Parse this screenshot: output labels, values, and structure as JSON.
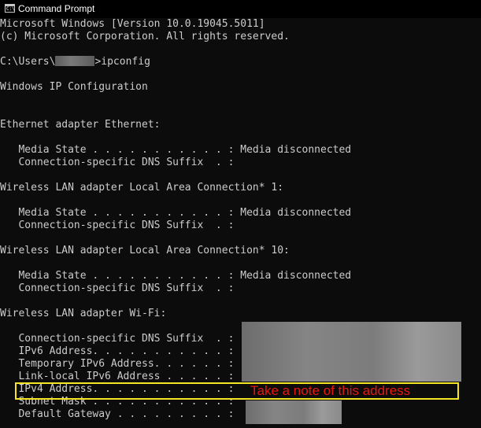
{
  "window": {
    "title": "Command Prompt",
    "icon_glyph": "C:\\",
    "icon": "console-app-icon"
  },
  "console": {
    "banner": [
      "Microsoft Windows [Version 10.0.19045.5011]",
      "(c) Microsoft Corporation. All rights reserved."
    ],
    "prompt_prefix": "C:\\Users\\",
    "prompt_suffix": ">ipconfig",
    "heading": "Windows IP Configuration",
    "adapters": [
      {
        "header": "Ethernet adapter Ethernet:",
        "lines": [
          "   Media State . . . . . . . . . . . : Media disconnected",
          "   Connection-specific DNS Suffix  . :"
        ]
      },
      {
        "header": "Wireless LAN adapter Local Area Connection* 1:",
        "lines": [
          "   Media State . . . . . . . . . . . : Media disconnected",
          "   Connection-specific DNS Suffix  . :"
        ]
      },
      {
        "header": "Wireless LAN adapter Local Area Connection* 10:",
        "lines": [
          "   Media State . . . . . . . . . . . : Media disconnected",
          "   Connection-specific DNS Suffix  . :"
        ]
      },
      {
        "header": "Wireless LAN adapter Wi-Fi:",
        "lines": [
          "   Connection-specific DNS Suffix  . :",
          "   IPv6 Address. . . . . . . . . . . :",
          "   Temporary IPv6 Address. . . . . . :",
          "   Link-local IPv6 Address . . . . . :",
          "   IPv4 Address. . . . . . . . . . . :",
          "   Subnet Mask . . . . . . . . . . . :",
          "   Default Gateway . . . . . . . . . :"
        ]
      }
    ]
  },
  "annotation": {
    "text": "Take a note of this address",
    "text_color": "#e8170c",
    "box_color": "#f5e625"
  },
  "colors": {
    "console_background": "#0c0c0c",
    "console_text": "#cccccc",
    "titlebar_background": "#000000"
  }
}
